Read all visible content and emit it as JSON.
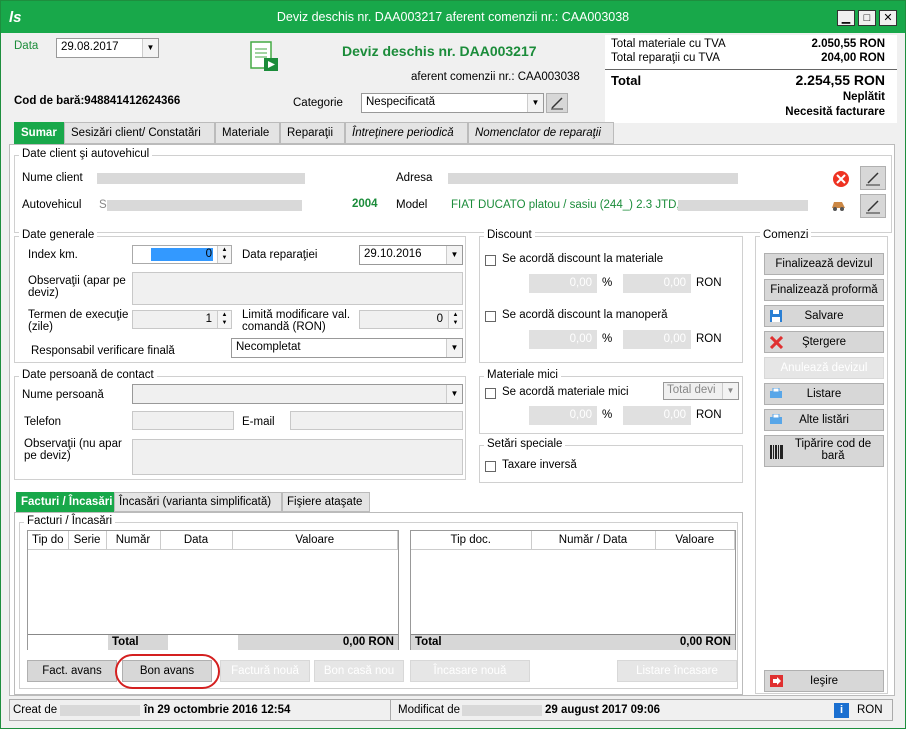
{
  "window": {
    "title": "Deviz deschis nr. DAA003217 aferent comenzii nr.: CAA003038"
  },
  "header": {
    "data_label": "Data",
    "data_value": "29.08.2017",
    "doc_title": "Deviz deschis nr. DAA003217",
    "doc_subtitle": "aferent comenzii nr.: CAA003038",
    "barcode_label": "Cod de bară:",
    "barcode_value": "948841412624366",
    "categorie_label": "Categorie",
    "categorie_value": "Nespecificată"
  },
  "totals": {
    "materiale_label": "Total materiale cu TVA",
    "materiale_value": "2.050,55 RON",
    "reparatii_label": "Total reparaţii cu TVA",
    "reparatii_value": "204,00 RON",
    "total_label": "Total",
    "total_value": "2.254,55 RON",
    "status1": "Neplătit",
    "status2": "Necesită facturare"
  },
  "tabs": [
    "Sumar",
    "Sesizări client/ Constatări",
    "Materiale",
    "Reparaţii",
    "Întreţinere periodică",
    "Nomenclator de reparaţii"
  ],
  "client": {
    "group_title": "Date client şi autovehicul",
    "nume_label": "Nume client",
    "adresa_label": "Adresa",
    "auto_label": "Autovehicul",
    "auto_prefix": "S",
    "year": "2004",
    "model_label": "Model",
    "model_value": "FIAT DUCATO platou / sasiu (244_) 2.3 JTD,"
  },
  "generale": {
    "group_title": "Date generale",
    "index_label": "Index km.",
    "index_value": "0",
    "data_rep_label": "Data reparaţiei",
    "data_rep_value": "29.10.2016",
    "obs_label": "Observaţii (apar pe deviz)",
    "termen_label": "Termen de execuţie (zile)",
    "termen_value": "1",
    "limita_label": "Limită modificare val. comandă (RON)",
    "limita_value": "0",
    "resp_label": "Responsabil verificare finală",
    "resp_value": "Necompletat"
  },
  "contact": {
    "group_title": "Date persoană de contact",
    "nume_label": "Nume persoană",
    "telefon_label": "Telefon",
    "email_label": "E-mail",
    "obs_label": "Observaţii (nu apar pe deviz)"
  },
  "discount": {
    "group_title": "Discount",
    "mat_label": "Se acordă discount la materiale",
    "mat_val1": "0,00",
    "mat_pct": "%",
    "mat_val2": "0,00",
    "mat_cur": "RON",
    "man_label": "Se acordă discount la manoperă",
    "man_val1": "0,00",
    "man_pct": "%",
    "man_val2": "0,00",
    "man_cur": "RON"
  },
  "mici": {
    "group_title": "Materiale mici",
    "label": "Se acordă materiale mici",
    "combo": "Total devi",
    "val1": "0,00",
    "pct": "%",
    "val2": "0,00",
    "cur": "RON"
  },
  "speciale": {
    "group_title": "Setări speciale",
    "label": "Taxare inversă"
  },
  "comenzi": {
    "group_title": "Comenzi",
    "finalizeaza": "Finalizează devizul",
    "proforma": "Finalizează proformă",
    "salvare": "Salvare",
    "stergere": "Ştergere",
    "anuleaza": "Anulează devizul",
    "listare": "Listare",
    "alte": "Alte listări",
    "tiparire": "Tipărire cod de bară",
    "iesire": "Ieşire"
  },
  "lower_tabs": [
    "Facturi / Încasări",
    "Încasări (varianta simplificată)",
    "Fişiere ataşate"
  ],
  "facturi": {
    "group_title": "Facturi / Încasări",
    "left_cols": [
      "Tip do",
      "Serie",
      "Număr",
      "Data",
      "Valoare"
    ],
    "right_cols": [
      "Tip doc.",
      "Număr / Data",
      "Valoare"
    ],
    "left_total_label": "Total",
    "left_total_value": "0,00 RON",
    "right_total_label": "Total",
    "right_total_value": "0,00 RON",
    "btn_fact_avans": "Fact. avans",
    "btn_bon_avans": "Bon avans",
    "btn_factura_noua": "Factură nouă",
    "btn_bon_casa": "Bon casă nou",
    "btn_incasare": "Încasare nouă",
    "btn_listare": "Listare încasare"
  },
  "status": {
    "creat_label": "Creat de",
    "creat_date": "în 29 octombrie 2016 12:54",
    "modificat_label": "Modificat de",
    "modificat_date": "29 august 2017 09:06",
    "currency": "RON"
  },
  "colors": {
    "accent": "#18a84a",
    "green_text": "#1b8c3a"
  }
}
